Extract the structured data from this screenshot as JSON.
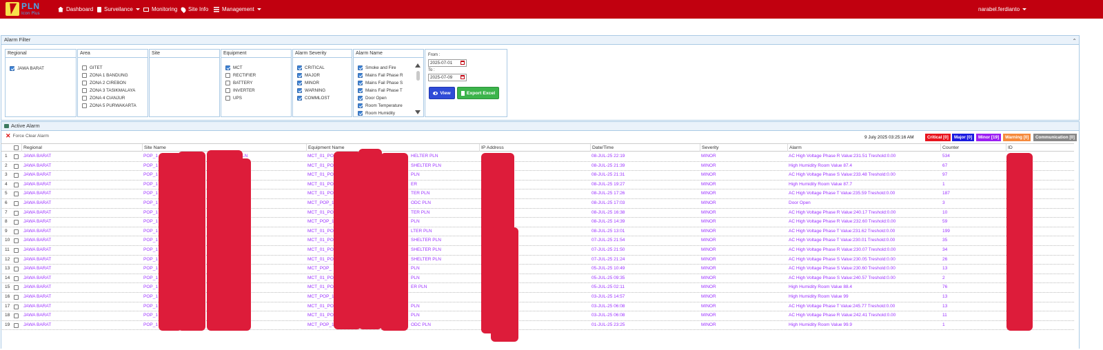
{
  "nav": {
    "logo_text": "PLN",
    "logo_sub": "Icon Plus",
    "items": [
      {
        "label": "Dashboard",
        "icon": "home-icon"
      },
      {
        "label": "Surveilance",
        "icon": "doc-icon"
      },
      {
        "label": "Monitoring",
        "icon": "monitor-icon"
      },
      {
        "label": "Site Info",
        "icon": "pin-icon"
      },
      {
        "label": "Management",
        "icon": "list-icon"
      }
    ],
    "user": "narabel.ferdianto"
  },
  "filter": {
    "title": "Alarm Filter",
    "regional": {
      "title": "Regional",
      "options": [
        {
          "label": "JAWA BARAT",
          "checked": true
        }
      ]
    },
    "area": {
      "title": "Area",
      "options": [
        {
          "label": "GITET",
          "checked": false
        },
        {
          "label": "ZONA 1 BANDUNG",
          "checked": false
        },
        {
          "label": "ZONA 2 CIREBON",
          "checked": false
        },
        {
          "label": "ZONA 3 TASIKMALAYA",
          "checked": false
        },
        {
          "label": "ZONA 4 CIANJUR",
          "checked": false
        },
        {
          "label": "ZONA 5 PURWAKARTA",
          "checked": false
        }
      ]
    },
    "site": {
      "title": "Site"
    },
    "equipment": {
      "title": "Equipment",
      "options": [
        {
          "label": "MCT",
          "checked": true
        },
        {
          "label": "RECTIFIER",
          "checked": false
        },
        {
          "label": "BATTERY",
          "checked": false
        },
        {
          "label": "INVERTER",
          "checked": false
        },
        {
          "label": "UPS",
          "checked": false
        }
      ]
    },
    "severity": {
      "title": "Alarm Severity",
      "options": [
        {
          "label": "CRITICAL",
          "checked": true
        },
        {
          "label": "MAJOR",
          "checked": true
        },
        {
          "label": "MINOR",
          "checked": true
        },
        {
          "label": "WARNING",
          "checked": true
        },
        {
          "label": "COMMLOST",
          "checked": true
        }
      ]
    },
    "alarm_name": {
      "title": "Alarm Name",
      "options": [
        {
          "label": "Smoke and Fire",
          "checked": true
        },
        {
          "label": "Mains Fail Phase R",
          "checked": true
        },
        {
          "label": "Mains Fail Phase S",
          "checked": true
        },
        {
          "label": "Mains Fail Phase T",
          "checked": true
        },
        {
          "label": "Door Open",
          "checked": true
        },
        {
          "label": "Room Temperature",
          "checked": true
        },
        {
          "label": "Room Humidity",
          "checked": true
        }
      ]
    },
    "from_label": "From :",
    "from_value": "2025-07-01",
    "to_label": "To :",
    "to_value": "2025-07-09",
    "view_label": "View",
    "excel_label": "Export Excel"
  },
  "active": {
    "title": "Active Alarm",
    "force_clear": "Force Clear Alarm",
    "datetime": "9 July 2025 03:25:16 AM",
    "badges": [
      {
        "label": "Critical [0]",
        "color": "#e8141e"
      },
      {
        "label": "Major [0]",
        "color": "#1a1ae0"
      },
      {
        "label": "Minor [19]",
        "color": "#9b1ff2"
      },
      {
        "label": "Warning [0]",
        "color": "#f58a3c"
      },
      {
        "label": "Communication [0]",
        "color": "#888888"
      }
    ],
    "columns": [
      "Regional",
      "Site Name",
      "Equipment Name",
      "IP Address",
      "Date/Time",
      "Severity",
      "Alarm",
      "Counter",
      "ID"
    ],
    "rows": [
      {
        "no": "1",
        "regional": "JAWA BARAT",
        "site": "POP_1",
        "site_tail": "LN",
        "equip": "MCT_01_PO",
        "equip_tail": "HELTER PLN",
        "date": "08-JUL-25 22:19",
        "severity": "MINOR",
        "alarm": "AC High Voltage Phase R Value:231.51 Treshold:0.00",
        "counter": "534"
      },
      {
        "no": "2",
        "regional": "JAWA BARAT",
        "site": "POP_1",
        "site_tail": "PLN",
        "equip": "MCT_01_PO",
        "equip_tail": "SHELTER PLN",
        "date": "08-JUL-25 21:39",
        "severity": "MINOR",
        "alarm": "High Humidity Room Value 87.4",
        "counter": "67"
      },
      {
        "no": "3",
        "regional": "JAWA BARAT",
        "site": "POP_1",
        "site_tail": "",
        "equip": "MCT_01_PO",
        "equip_tail": "PLN",
        "date": "08-JUL-25 21:31",
        "severity": "MINOR",
        "alarm": "AC High Voltage Phase S Value:233.48 Treshold:0.00",
        "counter": "97"
      },
      {
        "no": "4",
        "regional": "JAWA BARAT",
        "site": "POP_1",
        "site_tail": "",
        "equip": "MCT_01_PO",
        "equip_tail": "ER",
        "date": "08-JUL-25 19:27",
        "severity": "MINOR",
        "alarm": "High Humidity Room Value 87.7",
        "counter": "1"
      },
      {
        "no": "5",
        "regional": "JAWA BARAT",
        "site": "POP_1",
        "site_tail": "",
        "equip": "MCT_01_PO",
        "equip_tail": "TER PLN",
        "date": "08-JUL-25 17:26",
        "severity": "MINOR",
        "alarm": "AC High Voltage Phase T Value:235.59 Treshold:0.00",
        "counter": "187"
      },
      {
        "no": "6",
        "regional": "JAWA BARAT",
        "site": "POP_1",
        "site_tail": "PLN",
        "equip": "MCT_POP_1",
        "equip_tail": "ODC PLN",
        "date": "08-JUL-25 17:03",
        "severity": "MINOR",
        "alarm": "Door Open",
        "counter": "3"
      },
      {
        "no": "7",
        "regional": "JAWA BARAT",
        "site": "POP_1",
        "site_tail": "",
        "equip": "MCT_01_PO",
        "equip_tail": "TER PLN",
        "date": "08-JUL-25 16:38",
        "severity": "MINOR",
        "alarm": "AC High Voltage Phase R Value:240.17 Treshold:0.00",
        "counter": "10"
      },
      {
        "no": "8",
        "regional": "JAWA BARAT",
        "site": "POP_1",
        "site_tail": "",
        "equip": "MCT_POP_1",
        "equip_tail": "PLN",
        "date": "08-JUL-25 14:39",
        "severity": "MINOR",
        "alarm": "AC High Voltage Phase R Value:232.60 Treshold:0.00",
        "counter": "59"
      },
      {
        "no": "9",
        "regional": "JAWA BARAT",
        "site": "POP_1",
        "site_tail": "N",
        "equip": "MCT_01_PO",
        "equip_tail": "LTER PLN",
        "date": "08-JUL-25 13:01",
        "severity": "MINOR",
        "alarm": "AC High Voltage Phase T Value:231.62 Treshold:0.00",
        "counter": "199"
      },
      {
        "no": "10",
        "regional": "JAWA BARAT",
        "site": "POP_1",
        "site_tail": "LN",
        "equip": "MCT_01_PO",
        "equip_tail": "SHELTER PLN",
        "date": "07-JUL-25 21:54",
        "severity": "MINOR",
        "alarm": "AC High Voltage Phase T Value:230.01 Treshold:0.00",
        "counter": "35"
      },
      {
        "no": "11",
        "regional": "JAWA BARAT",
        "site": "POP_1",
        "site_tail": "LN",
        "equip": "MCT_01_PO",
        "equip_tail": "SHELTER PLN",
        "date": "07-JUL-25 21:50",
        "severity": "MINOR",
        "alarm": "AC High Voltage Phase R Value:230.07 Treshold:0.00",
        "counter": "34"
      },
      {
        "no": "12",
        "regional": "JAWA BARAT",
        "site": "POP_1",
        "site_tail": "LN",
        "equip": "MCT_01_PO",
        "equip_tail": "SHELTER PLN",
        "date": "07-JUL-25 21:24",
        "severity": "MINOR",
        "alarm": "AC High Voltage Phase S Value:230.05 Treshold:0.00",
        "counter": "26"
      },
      {
        "no": "13",
        "regional": "JAWA BARAT",
        "site": "POP_1",
        "site_tail": "",
        "equip": "MCT_POP_",
        "equip_tail": "PLN",
        "date": "05-JUL-25 10:49",
        "severity": "MINOR",
        "alarm": "AC High Voltage Phase S Value:230.60 Treshold:0.00",
        "counter": "13"
      },
      {
        "no": "14",
        "regional": "JAWA BARAT",
        "site": "POP_1",
        "site_tail": "",
        "equip": "MCT_01_PO",
        "equip_tail": "PLN",
        "date": "05-JUL-25 09:35",
        "severity": "MINOR",
        "alarm": "AC High Voltage Phase S Value:240.57 Treshold:0.00",
        "counter": "2"
      },
      {
        "no": "15",
        "regional": "JAWA BARAT",
        "site": "POP_1",
        "site_tail": "",
        "equip": "MCT_01_PO",
        "equip_tail": "ER PLN",
        "date": "05-JUL-25 02:11",
        "severity": "MINOR",
        "alarm": "High Humidity Room Value 88.4",
        "counter": "76"
      },
      {
        "no": "16",
        "regional": "JAWA BARAT",
        "site": "POP_1",
        "site_tail": "",
        "equip": "MCT_POP_1",
        "equip_tail": "",
        "date": "03-JUL-25 14:57",
        "severity": "MINOR",
        "alarm": "High Humidity Room Value 99",
        "counter": "13"
      },
      {
        "no": "17",
        "regional": "JAWA BARAT",
        "site": "POP_1",
        "site_tail": "",
        "equip": "MCT_01_PO",
        "equip_tail": "PLN",
        "date": "03-JUL-25 06:08",
        "severity": "MINOR",
        "alarm": "AC High Voltage Phase T Value:245.77 Treshold:0.00",
        "counter": "13"
      },
      {
        "no": "18",
        "regional": "JAWA BARAT",
        "site": "POP_1",
        "site_tail": "",
        "equip": "MCT_01_PO",
        "equip_tail": "PLN",
        "date": "03-JUL-25 06:08",
        "severity": "MINOR",
        "alarm": "AC High Voltage Phase R Value:242.41 Treshold:0.00",
        "counter": "11"
      },
      {
        "no": "19",
        "regional": "JAWA BARAT",
        "site": "POP_1",
        "site_tail": "",
        "equip": "MCT_POP_1",
        "equip_tail": "ODC PLN",
        "date": "01-JUL-25 23:25",
        "severity": "MINOR",
        "alarm": "High Humidity Room Value 99.9",
        "counter": "1"
      }
    ]
  },
  "colors": {
    "navbar": "#c1000f",
    "row_text": "#9b30ff",
    "redaction": "#dd1c3a"
  }
}
